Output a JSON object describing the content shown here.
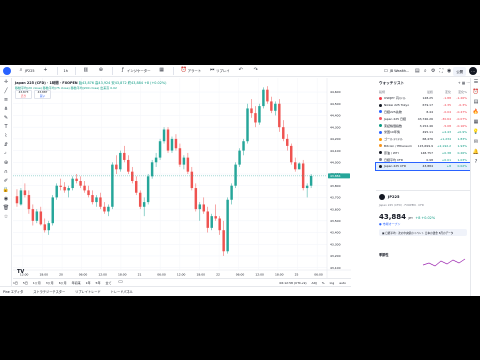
{
  "topbar": {
    "symbol": "JP225",
    "timeframe": "1h",
    "indicators_label": "インジケーター",
    "alert_label": "アラート",
    "replay_label": "リプレイ",
    "layout_name": "JB Wealth...",
    "publish_label": "公開"
  },
  "legend": {
    "title": "Japan 225 (CFD) · 1時間 · FXOPEN",
    "open": "始43,876",
    "high": "高43,924",
    "low": "安43,872",
    "close": "終43,884",
    "change": "+8 (+0.02%)",
    "indicators": "移動平均(20 close) 移動平均(75 close) 移動平均(200 close) 出来高 0.02"
  },
  "price_boxes": {
    "sell_price": "43,873",
    "sell_label": "売り",
    "buy_price": "43,887",
    "buy_label": "買い"
  },
  "last_price_label": "43,884",
  "bottombar": {
    "ranges": [
      "1日",
      "5日",
      "1ヶ月",
      "3ヶ月",
      "6ヶ月",
      "年初来",
      "1年",
      "5年",
      "全て"
    ],
    "timestamp": "06:12:58 (UTC+9)",
    "adj": "ADJ",
    "pct": "%",
    "log": "log",
    "auto": "auto"
  },
  "control_tabs": [
    "Pine エディタ",
    "ストラテジーテスター",
    "リプレイトレード",
    "トレードパネル"
  ],
  "tv_logo": "TV",
  "watchlist": {
    "title": "ウォッチリスト",
    "actions": "+ ▦ ⋯",
    "columns": {
      "symbol": "銘柄",
      "last": "最終",
      "change": "変化",
      "change_pct": "変化%"
    },
    "rows": [
      {
        "name": "USDJPY 円/ドル",
        "last": "148.25",
        "chg": "-1.88",
        "pct": "-1.26%",
        "dir": "dn",
        "color": "#f23645"
      },
      {
        "name": "Nikkei 225 Tokyo",
        "last": "679.17",
        "chg": "-2.35",
        "pct": "-0.3%",
        "dir": "dn",
        "color": "#131722"
      },
      {
        "name": "日経225先物",
        "last": "8.44",
        "chg": "-0.04",
        "pct": "-0.47%",
        "dir": "dn",
        "color": "#2962ff"
      },
      {
        "name": "Japan 225 日経",
        "last": "43,746.26",
        "chg": "-30.64",
        "pct": "-0.07%",
        "dir": "dn",
        "color": "#f7525f"
      },
      {
        "name": "東証株価指数",
        "last": "3,152.46",
        "chg": "-5.08",
        "pct": "-0.16%",
        "dir": "dn",
        "color": "#089981"
      },
      {
        "name": "米国10年債",
        "last": "495.11",
        "chg": "+4.43",
        "pct": "+0.9%",
        "dir": "up",
        "color": "#2962ff"
      },
      {
        "name": "ゴールド/ドル",
        "last": "68,476",
        "chg": "+1,234",
        "pct": "1.83%",
        "dir": "up",
        "color": "#ff9800"
      },
      {
        "name": "Bitcoin / Ethereum",
        "last": "115,699.9",
        "chg": "+2,192.2",
        "pct": "1.93%",
        "dir": "up",
        "color": "#f7931a"
      },
      {
        "name": "原油 / WTI",
        "last": "148.757",
        "chg": "+0.38",
        "pct": "0.26%",
        "dir": "up",
        "color": "#131722"
      },
      {
        "name": "日経平均 CFD",
        "last": "0.98",
        "chg": "+0.01",
        "pct": "1.03%",
        "dir": "up",
        "color": "#787b86"
      },
      {
        "name": "Japan 225 CFD",
        "last": "43,884",
        "chg": "+8",
        "pct": "0.02%",
        "dir": "up",
        "color": "#131722",
        "selected": true
      }
    ]
  },
  "detail": {
    "symbol": "JP225",
    "subtitle": "Japan 225 (CFD) · FXOPEN · CFD",
    "price": "43,884",
    "unit": "JPY",
    "change": "+8 +0.02%",
    "status": "● 市場オープン",
    "announcement": "▣ 日経平均 : 次の中央値のイベント 日本の賃金 8月のデータ",
    "section": "季節性"
  },
  "chart_data": {
    "type": "candlestick",
    "ylim": [
      43080,
      44720
    ],
    "y_ticks": [
      "44,600",
      "44,500",
      "44,400",
      "44,300",
      "44,200",
      "44,100",
      "44,000",
      "43,900",
      "43,800",
      "43,700",
      "43,600",
      "43,500",
      "43,400",
      "43,300",
      "43,200",
      "43,100"
    ],
    "x_ticks": [
      "12:00",
      "18:00",
      "20",
      "06:00",
      "12:00",
      "18:00",
      "21",
      "06:00",
      "12:00",
      "18:00",
      "22",
      "06:00",
      "12:00",
      "18:00",
      "25",
      "06:00"
    ],
    "candles": [
      [
        43710,
        43770,
        43620,
        43650
      ],
      [
        43640,
        43780,
        43630,
        43760
      ],
      [
        43760,
        43820,
        43700,
        43720
      ],
      [
        43720,
        43760,
        43560,
        43600
      ],
      [
        43600,
        43640,
        43460,
        43500
      ],
      [
        43500,
        43600,
        43480,
        43580
      ],
      [
        43580,
        43620,
        43460,
        43470
      ],
      [
        43470,
        43520,
        43400,
        43420
      ],
      [
        43420,
        43500,
        43380,
        43480
      ],
      [
        43480,
        43720,
        43460,
        43700
      ],
      [
        43700,
        43820,
        43680,
        43800
      ],
      [
        43800,
        43860,
        43760,
        43790
      ],
      [
        43790,
        43830,
        43740,
        43760
      ],
      [
        43760,
        43800,
        43700,
        43780
      ],
      [
        43780,
        43880,
        43760,
        43860
      ],
      [
        43860,
        43900,
        43820,
        43840
      ],
      [
        43840,
        43880,
        43780,
        43800
      ],
      [
        43800,
        43840,
        43740,
        43760
      ],
      [
        43760,
        43800,
        43700,
        43720
      ],
      [
        43720,
        43760,
        43640,
        43660
      ],
      [
        43660,
        43720,
        43620,
        43700
      ],
      [
        43700,
        43740,
        43600,
        43620
      ],
      [
        43620,
        43660,
        43560,
        43580
      ],
      [
        43580,
        43640,
        43540,
        43620
      ],
      [
        43620,
        44000,
        43600,
        43980
      ],
      [
        43980,
        44060,
        43900,
        43940
      ],
      [
        43940,
        44100,
        43920,
        44080
      ],
      [
        44080,
        44140,
        44000,
        44020
      ],
      [
        44020,
        44060,
        43900,
        43920
      ],
      [
        43920,
        43960,
        43820,
        43840
      ],
      [
        43840,
        43880,
        43720,
        43740
      ],
      [
        43740,
        43760,
        43600,
        43620
      ],
      [
        43620,
        43700,
        43540,
        43660
      ],
      [
        43660,
        43900,
        43640,
        43880
      ],
      [
        43880,
        44020,
        43860,
        44000
      ],
      [
        44000,
        44080,
        43960,
        44040
      ],
      [
        44040,
        44200,
        44020,
        44180
      ],
      [
        44180,
        44300,
        44160,
        44280
      ],
      [
        44280,
        44300,
        44080,
        44100
      ],
      [
        44100,
        44220,
        44080,
        44200
      ],
      [
        44200,
        44240,
        44100,
        44120
      ],
      [
        44120,
        44160,
        43960,
        43980
      ],
      [
        43980,
        44060,
        43940,
        44040
      ],
      [
        44040,
        44080,
        43900,
        43920
      ],
      [
        43920,
        43960,
        43760,
        43780
      ],
      [
        43780,
        43820,
        43580,
        43600
      ],
      [
        43600,
        43660,
        43500,
        43640
      ],
      [
        43640,
        43700,
        43560,
        43580
      ],
      [
        43580,
        43620,
        43400,
        43440
      ],
      [
        43440,
        43560,
        43420,
        43540
      ],
      [
        43540,
        43640,
        43500,
        43520
      ],
      [
        43520,
        43540,
        43380,
        43420
      ],
      [
        43420,
        43500,
        43200,
        43240
      ],
      [
        43240,
        43700,
        43220,
        43680
      ],
      [
        43680,
        43820,
        43640,
        43800
      ],
      [
        43800,
        44000,
        43780,
        43980
      ],
      [
        43980,
        44120,
        43960,
        44100
      ],
      [
        44100,
        44200,
        44060,
        44180
      ],
      [
        44180,
        44500,
        44160,
        44460
      ],
      [
        44460,
        44540,
        44380,
        44420
      ],
      [
        44420,
        44480,
        44300,
        44340
      ],
      [
        44340,
        44500,
        44320,
        44480
      ],
      [
        44480,
        44640,
        44460,
        44620
      ],
      [
        44620,
        44650,
        44500,
        44520
      ],
      [
        44520,
        44560,
        44420,
        44440
      ],
      [
        44440,
        44520,
        44400,
        44500
      ],
      [
        44500,
        44540,
        44260,
        44300
      ],
      [
        44300,
        44360,
        44180,
        44200
      ],
      [
        44200,
        44240,
        44100,
        44140
      ],
      [
        44140,
        44160,
        43980,
        44000
      ],
      [
        44000,
        44040,
        43920,
        43940
      ],
      [
        43940,
        44000,
        43940,
        43990
      ],
      [
        43990,
        44020,
        43760,
        43780
      ],
      [
        43780,
        43820,
        43700,
        43800
      ],
      [
        43800,
        43900,
        43780,
        43884
      ]
    ]
  }
}
